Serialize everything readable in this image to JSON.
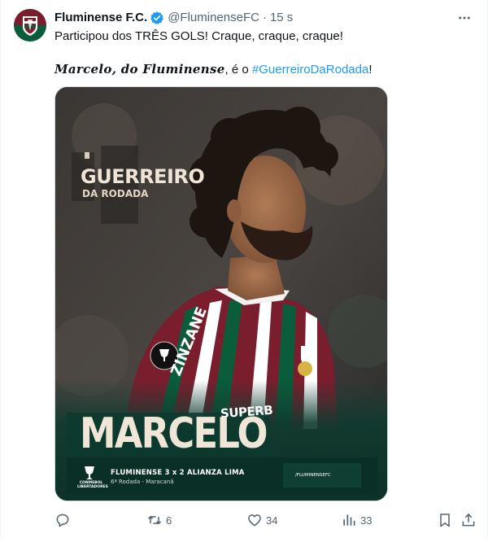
{
  "account": {
    "name": "Fluminense F.C.",
    "handle": "@FluminenseFC",
    "separator": "·",
    "time": "15 s"
  },
  "tweet": {
    "line1": "Participou dos TRÊS GOLS! Craque, craque, craque!",
    "line2_script": "Marcelo, do Fluminense",
    "line2_mid": ", é o ",
    "line2_hashtag": "#GuerreiroDaRodada",
    "line2_end": "!"
  },
  "media": {
    "title_main": "GUERREIRO",
    "title_sub": "DA RODADA",
    "player": "MARCELO",
    "jersey_brand": "SUPERB",
    "jersey_sleeve": "ZINZANE",
    "match": "FLUMINENSE 3 x 2 ALIANZA LIMA",
    "match_detail": "6ª Rodada - Maracanã",
    "competition": "CONMEBOL LIBERTADORES",
    "social_handle": "/FLUMINENSEFC"
  },
  "actions": {
    "reply_count": "",
    "retweet_count": "6",
    "like_count": "34",
    "views_count": "33"
  },
  "colors": {
    "text": "#0f1419",
    "muted": "#536471",
    "link": "#1d9bf0",
    "verified": "#1d9bf0",
    "club_maroon": "#7a1e2e",
    "club_green": "#0b5c3b"
  }
}
